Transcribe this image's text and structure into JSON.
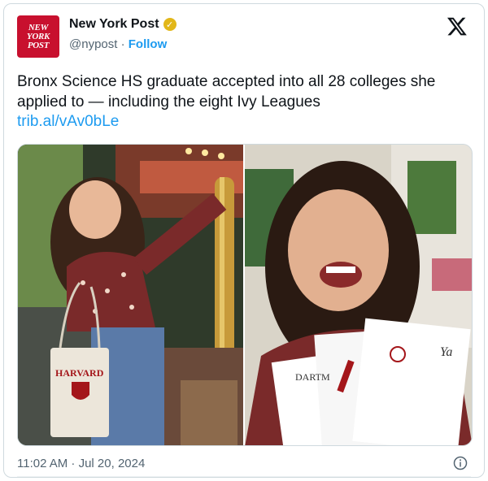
{
  "account": {
    "logo_lines": [
      "NEW",
      "YORK",
      "POST"
    ],
    "name": "New York Post",
    "handle": "@nypost",
    "separator": "·",
    "follow_label": "Follow",
    "verified_color": "#e2b719"
  },
  "tweet": {
    "text": "Bronx Science HS graduate accepted into all 28 colleges she applied to — including the eight Ivy Leagues",
    "link": "trib.al/vAv0bLe"
  },
  "media": {
    "left_photo": {
      "tote_lines": [
        "HARVARD"
      ]
    },
    "right_photo": {
      "letter_texts": [
        "DARTM",
        "Ya"
      ]
    }
  },
  "footer": {
    "timestamp": "11:02 AM · Jul 20, 2024"
  },
  "icons": {
    "platform": "x-logo-icon",
    "info": "info-icon",
    "verified": "verified-badge-icon"
  },
  "colors": {
    "brand_red": "#c8102e",
    "link_blue": "#1d9bf0",
    "muted": "#536471"
  }
}
